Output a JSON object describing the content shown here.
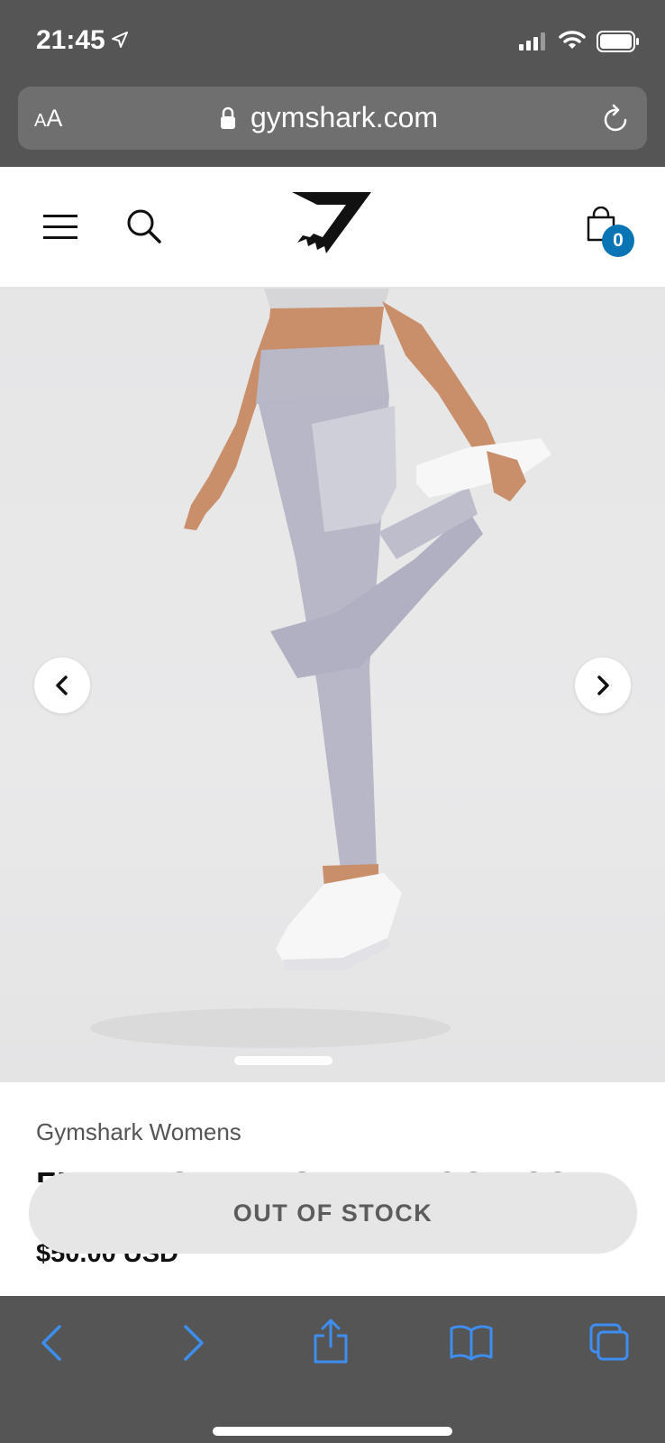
{
  "status_bar": {
    "time": "21:45",
    "icons": [
      "location-arrow-icon",
      "cellular-signal-icon",
      "wifi-icon",
      "battery-icon"
    ]
  },
  "browser": {
    "text_size_label": "AA",
    "url": "gymshark.com",
    "icons": [
      "lock-icon",
      "reload-icon"
    ]
  },
  "header": {
    "icons": [
      "menu-icon",
      "search-icon",
      "gymshark-logo",
      "cart-icon"
    ],
    "cart_count": "0"
  },
  "gallery": {
    "icons": [
      "chevron-left-icon",
      "chevron-right-icon"
    ],
    "current_slide": 1
  },
  "product": {
    "brand": "Gymshark Womens",
    "title": "FLEX HIGH WAISTED LEGGINGS",
    "price": "$50.00 USD",
    "stock_button": "OUT OF STOCK"
  },
  "toolbar": {
    "icons": [
      "back-icon",
      "forward-icon",
      "share-icon",
      "bookmarks-icon",
      "tabs-icon"
    ],
    "accent_color": "#3d8ef0"
  },
  "colors": {
    "chrome": "#555555",
    "badge": "#0a75b5",
    "button_bg": "#e6e6e6"
  }
}
